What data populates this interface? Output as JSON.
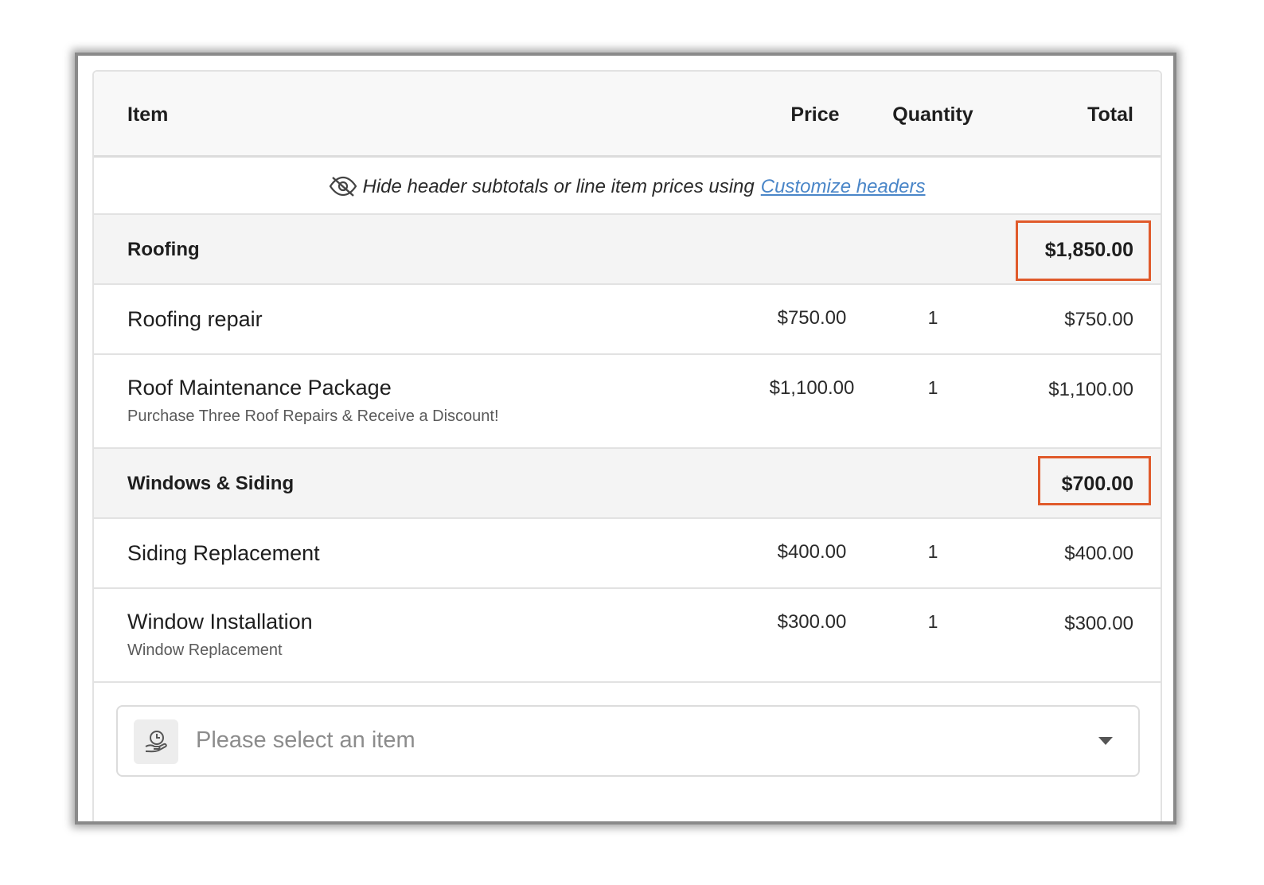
{
  "columns": {
    "item": "Item",
    "price": "Price",
    "quantity": "Quantity",
    "total": "Total"
  },
  "hint": {
    "text": "Hide header subtotals or line item prices using",
    "link": "Customize headers",
    "icon": "eye-off-icon"
  },
  "sections": [
    {
      "label": "Roofing",
      "subtotal": "$1,850.00",
      "items": [
        {
          "name": "Roofing repair",
          "description": "",
          "price": "$750.00",
          "quantity": "1",
          "total": "$750.00"
        },
        {
          "name": "Roof Maintenance Package",
          "description": "Purchase Three Roof Repairs & Receive a Discount!",
          "price": "$1,100.00",
          "quantity": "1",
          "total": "$1,100.00"
        }
      ]
    },
    {
      "label": "Windows & Siding",
      "subtotal": "$700.00",
      "items": [
        {
          "name": "Siding Replacement",
          "description": "",
          "price": "$400.00",
          "quantity": "1",
          "total": "$400.00"
        },
        {
          "name": "Window Installation",
          "description": "Window Replacement",
          "price": "$300.00",
          "quantity": "1",
          "total": "$300.00"
        }
      ]
    }
  ],
  "item_selector": {
    "placeholder": "Please select an item",
    "icon": "hand-clock-icon"
  },
  "colors": {
    "highlight": "#e05a2b",
    "link": "#4a86c8"
  }
}
